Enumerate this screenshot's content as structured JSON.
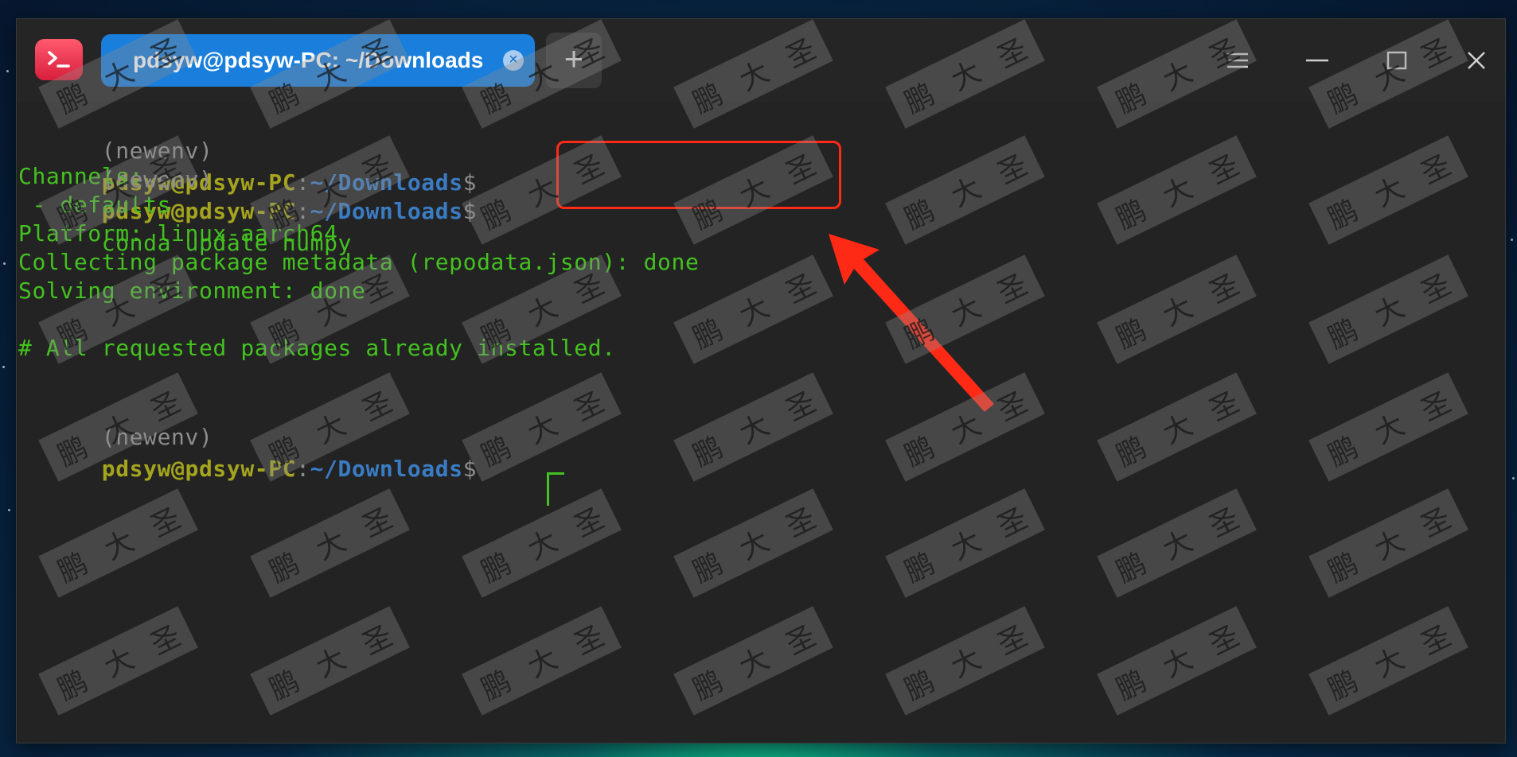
{
  "window": {
    "tab_title": "pdsyw@pdsyw-PC: ~/Downloads",
    "tab_close_symbol": "×",
    "new_tab_symbol": "+",
    "icons": [
      "terminal-app-icon",
      "menu-icon",
      "minimize-icon",
      "maximize-icon",
      "close-icon"
    ]
  },
  "terminal": {
    "prompt_env": "(newenv)",
    "prompt_user": "pdsyw@pdsyw-PC",
    "prompt_sep": ":",
    "prompt_path": "~/Downloads",
    "prompt_symbol": "$",
    "command": "conda update numpy",
    "output": [
      "Channels:",
      " - defaults",
      "Platform: linux-aarch64",
      "Collecting package metadata (repodata.json): done",
      "Solving environment: done",
      "",
      "# All requested packages already installed.",
      ""
    ]
  },
  "watermark": {
    "chars": [
      "鹏",
      "大",
      "圣"
    ]
  },
  "colors": {
    "accent_tab": "#1a7fdc",
    "terminal_bg": "#232323",
    "output_green": "#43c21f",
    "prompt_user": "#a4a41e",
    "prompt_path": "#3a7cc4",
    "annotation_red": "#ff2a16"
  }
}
